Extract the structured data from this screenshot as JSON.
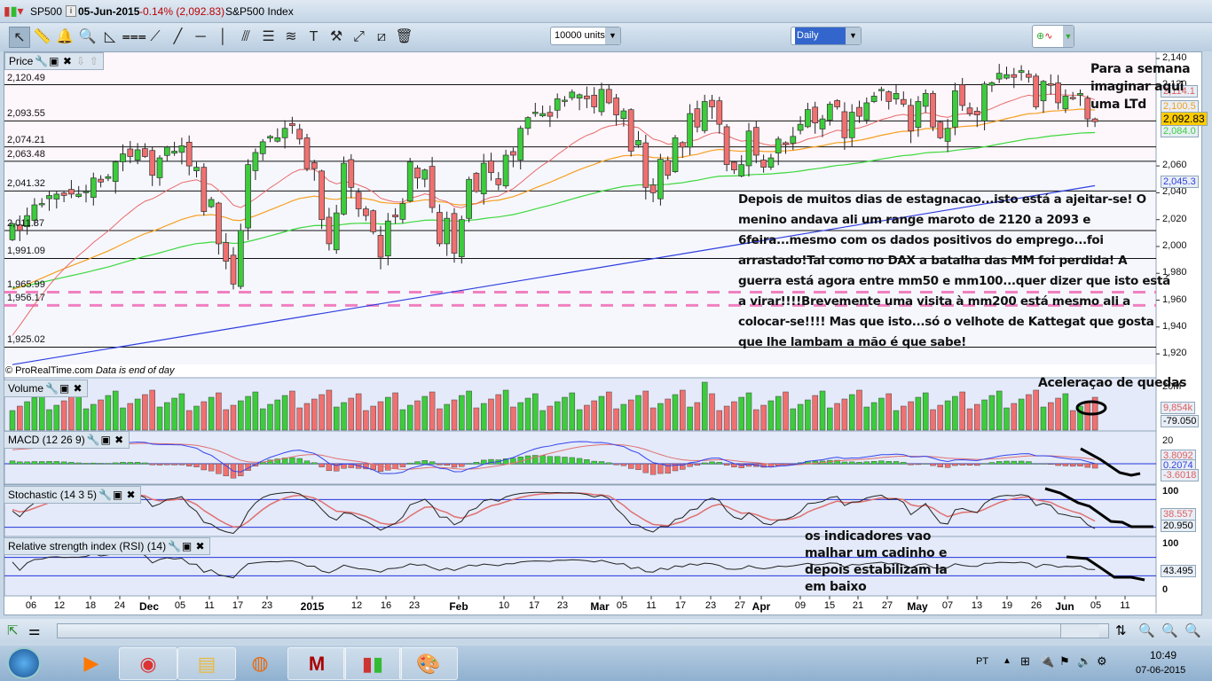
{
  "window": {
    "symbol": "SP500",
    "date": "05-Jun-2015",
    "change": "-0.14% (2,092.83)",
    "name": "S&P500 Index"
  },
  "toolbar": {
    "tools": [
      "pointer-icon",
      "ruler-icon",
      "alarm-bell-icon",
      "zoom-magnifier-icon",
      "triangle-pattern-icon",
      "channel-icon",
      "segment-icon",
      "line-icon",
      "horizontal-line-icon",
      "vertical-line-icon",
      "fibonacci-fan-icon",
      "fibonacci-retracement-icon",
      "regression-channel-icon",
      "text-icon",
      "properties-tools-icon",
      "parallel-line-icon",
      "trend-line-icon",
      "trash-icon"
    ],
    "units": "10000 units",
    "period": "Daily"
  },
  "price_panel": {
    "label": "Price",
    "copyright": "© ProRealTime.com",
    "eod": "Data is end of day",
    "levels": [
      2120.49,
      2093.55,
      2074.21,
      2063.48,
      2041.32,
      2011.87,
      1991.09,
      1965.99,
      1956.17,
      1925.02
    ],
    "level_labels": [
      "2,120.49",
      "2,093.55",
      "2,074.21",
      "2,063.48",
      "2,041.32",
      "2,011.87",
      "1,991.09",
      "1,965.99",
      "1,956.17",
      "1,925.02"
    ],
    "axis_values": [
      2140,
      2120,
      2060,
      2040,
      2020,
      2000,
      1980,
      1960,
      1940,
      1920
    ],
    "axis_labels": [
      "2,140",
      "2,120",
      "2,060",
      "2,040",
      "2,020",
      "2,000",
      "1,980",
      "1,960",
      "1,940",
      "1,920"
    ],
    "badges": {
      "ma20": "2,114.1",
      "ma50": "2,100.5",
      "last": "2,092.83",
      "ma100": "2,084.0",
      "ma200": "2,045.3"
    }
  },
  "chart_data": {
    "type": "candlestick",
    "closes": [
      2017,
      2012,
      2023,
      2031,
      2032,
      2038,
      2039,
      2038,
      2039,
      2039,
      2041,
      2051,
      2048,
      2052,
      2063,
      2069,
      2067,
      2072,
      2067,
      2053,
      2066,
      2074,
      2071,
      2075,
      2060,
      2059,
      2026,
      2035,
      2002,
      1989,
      1972,
      2012,
      2061,
      2070,
      2078,
      2082,
      2081,
      2088,
      2090,
      2080,
      2058,
      2058,
      2020,
      2002,
      2025,
      2062,
      2044,
      2028,
      2023,
      2011,
      1992,
      2019,
      2022,
      2032,
      2063,
      2051,
      2057,
      2029,
      2002,
      2021,
      1995,
      2020,
      2050,
      2041,
      2062,
      2055,
      2046,
      2068,
      2068,
      2088,
      2096,
      2100,
      2099,
      2097,
      2110,
      2109,
      2115,
      2113,
      2110,
      2104,
      2117,
      2107,
      2098,
      2101,
      2071,
      2079,
      2044,
      2040,
      2065,
      2053,
      2081,
      2074,
      2099,
      2089,
      2108,
      2104,
      2091,
      2061,
      2057,
      2061,
      2086,
      2068,
      2059,
      2066,
      2080,
      2076,
      2082,
      2091,
      2102,
      2092,
      2095,
      2106,
      2104,
      2081,
      2100,
      2097,
      2107,
      2112,
      2117,
      2108,
      2114,
      2106,
      2086,
      2108,
      2114,
      2089,
      2081,
      2088,
      2116,
      2105,
      2099,
      2098,
      2121,
      2122,
      2129,
      2128,
      2126,
      2131,
      2126,
      2104,
      2123,
      2120,
      2107,
      2112,
      2110,
      2114,
      2095,
      2093
    ]
  },
  "x_axis": [
    "06",
    "12",
    "18",
    "24",
    "Dec",
    "05",
    "11",
    "17",
    "23",
    "2015",
    "12",
    "16",
    "23",
    "Feb",
    "10",
    "17",
    "23",
    "Mar",
    "05",
    "11",
    "17",
    "23",
    "27",
    "Apr",
    "09",
    "15",
    "21",
    "27",
    "May",
    "07",
    "13",
    "19",
    "26",
    "Jun",
    "05",
    "11"
  ],
  "volume_panel": {
    "label": "Volume",
    "axis": "20M",
    "last": "9,854k",
    "other": "-79.050"
  },
  "macd_panel": {
    "label": "MACD (12 26 9)",
    "axis": "20",
    "v1": "3.8092",
    "v2": "0.2074",
    "v3": "-3.6018"
  },
  "stoch_panel": {
    "label": "Stochastic (14 3 5)",
    "axis": "100",
    "v1": "38.557",
    "v2": "20.950"
  },
  "rsi_panel": {
    "label": "Relative strength index (RSI) (14)",
    "axis_top": "100",
    "axis_bottom": "0",
    "value": "43.495"
  },
  "annotations": {
    "week": [
      "Para a semana",
      "imaginar aqui",
      "uma LTd"
    ],
    "main": [
      "Depois de muitos dias de estagnacao...isto está a ajeitar-se! O",
      "menino andava ali um range maroto de 2120 a 2093 e",
      "6feira...mesmo com os dados positivos do emprego...foi",
      "arrastado!Tal como no DAX a batalha das MM foi perdida! A",
      "guerra está agora entre mm50 e mm100...quer dizer que isto está",
      "a virar!!!!Brevemente uma visita à mm200 está mesmo ali a",
      "colocar-se!!!! Mas que isto...só o velhote de Kattegat que gosta",
      "que lhe lambam a mão é que sabe!"
    ],
    "volume": "Aceleraçao de quedas",
    "indicators": [
      "os indicadores vao",
      "malhar um cadinho e",
      "depois estabilizam la",
      "em baixo"
    ]
  },
  "taskbar": {
    "lang": "PT",
    "time": "10:49",
    "date": "07-06-2015"
  },
  "colors": {
    "up": "#3ccc3c",
    "down": "#f07070",
    "ma20": "#e86a6a",
    "ma50": "#f5a020",
    "ma100": "#3cd83c",
    "ma200": "#3040e0",
    "level_dash": "#f080c0"
  }
}
